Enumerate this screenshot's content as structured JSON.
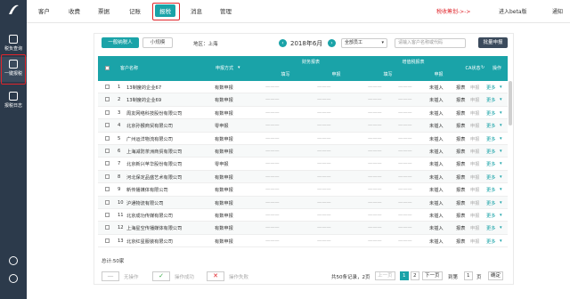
{
  "sidebar": {
    "items": [
      {
        "label": "税负查询"
      },
      {
        "label": "一键报税"
      },
      {
        "label": "报税日志"
      }
    ]
  },
  "topnav": {
    "items": [
      "客户",
      "收费",
      "票据",
      "记账",
      "报税",
      "消息",
      "管理"
    ],
    "trial": "税收筹划->->",
    "beta": "进入beta版",
    "notice": "通知"
  },
  "tabs": {
    "general": "一般纳税人",
    "small": "小规模"
  },
  "filter": {
    "region": "地区：上海",
    "month": "2018年6月",
    "staff": "全部员工",
    "search_placeholder": "请输入客户名称或代码",
    "batch": "批量申报"
  },
  "table": {
    "headers": {
      "name": "客户名称",
      "method": "申报方式",
      "finance": "财务报表",
      "vat": "增值税报表",
      "ca": "CA状态",
      "op": "操作",
      "fill": "填写",
      "declare": "申报"
    },
    "rows": [
      {
        "no": "1",
        "name": "13制度的企业67",
        "method": "有数申报",
        "ca": "未插入",
        "op1": "报表",
        "op2": "申报",
        "more": "更多"
      },
      {
        "no": "2",
        "name": "13制度的企业69",
        "method": "有数申报",
        "ca": "未插入",
        "op1": "报表",
        "op2": "申报",
        "more": "更多"
      },
      {
        "no": "3",
        "name": "周友网络科技股份有限公司",
        "method": "有数申报",
        "ca": "未插入",
        "op1": "报表",
        "op2": "申报",
        "more": "更多"
      },
      {
        "no": "4",
        "name": "北京孙猴商贸有限公司",
        "method": "零申报",
        "ca": "未插入",
        "op1": "报表",
        "op2": "申报",
        "more": "更多"
      },
      {
        "no": "5",
        "name": "广州运洋物流有限公司",
        "method": "有数申报",
        "ca": "未插入",
        "op1": "报表",
        "op2": "申报",
        "more": "更多"
      },
      {
        "no": "6",
        "name": "上海减防茶洲商贸有限公司",
        "method": "有数申报",
        "ca": "未插入",
        "op1": "报表",
        "op2": "申报",
        "more": "更多"
      },
      {
        "no": "7",
        "name": "北京新兴苹华股份有限公司",
        "method": "零申报",
        "ca": "未插入",
        "op1": "报表",
        "op2": "申报",
        "more": "更多"
      },
      {
        "no": "8",
        "name": "河北保定品盛艺术有限公司",
        "method": "有数申报",
        "ca": "未插入",
        "op1": "报表",
        "op2": "申报",
        "more": "更多"
      },
      {
        "no": "9",
        "name": "新传播媒体有限公司",
        "method": "有数申报",
        "ca": "未插入",
        "op1": "报表",
        "op2": "申报",
        "more": "更多"
      },
      {
        "no": "10",
        "name": "沪通物流有限公司",
        "method": "有数申报",
        "ca": "未插入",
        "op1": "报表",
        "op2": "申报",
        "more": "更多"
      },
      {
        "no": "11",
        "name": "北京成功传媒有限公司",
        "method": "有数申报",
        "ca": "未插入",
        "op1": "报表",
        "op2": "申报",
        "more": "更多"
      },
      {
        "no": "12",
        "name": "上海星空传播媒体有限公司",
        "method": "有数申报",
        "ca": "未插入",
        "op1": "报表",
        "op2": "申报",
        "more": "更多"
      },
      {
        "no": "13",
        "name": "北京红星服装有限公司",
        "method": "有数申报",
        "ca": "未插入",
        "op1": "报表",
        "op2": "申报",
        "more": "更多"
      }
    ]
  },
  "footer": {
    "total": "总计:50家",
    "legend_none": "无操作",
    "legend_ok": "操作成功",
    "legend_fail": "操作失败",
    "records": "共50条记录，2页",
    "prev": "上一页",
    "p1": "1",
    "p2": "2",
    "next": "下一页",
    "goto": "到第",
    "page_input": "1",
    "page_unit": "页",
    "confirm": "确定"
  },
  "colors": {
    "accent": "#1aa3a8",
    "sidebar": "#2c3a4b",
    "highlight": "#e0252b"
  }
}
